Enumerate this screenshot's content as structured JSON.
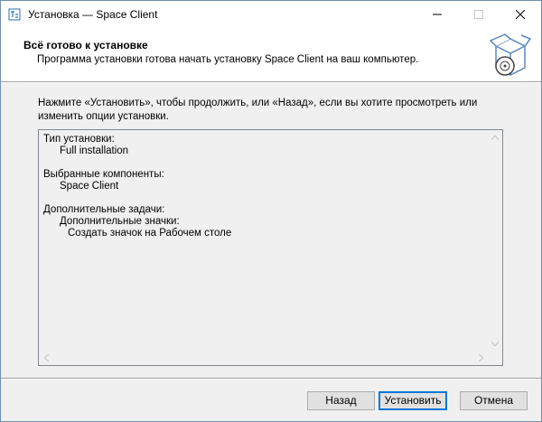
{
  "window": {
    "title": "Установка — Space Client",
    "icons": {
      "app": "installer-app-icon",
      "minimize": "minimize-icon",
      "maximize": "maximize-icon",
      "close": "close-icon"
    }
  },
  "header": {
    "title": "Всё готово к установке",
    "subtitle": "Программа установки готова начать установку Space Client на ваш компьютер.",
    "graphic_icon": "box-with-disc-icon"
  },
  "instructions": {
    "line1": "Нажмите «Установить», чтобы продолжить, или «Назад», если вы хотите просмотреть или",
    "line2": "изменить опции установки."
  },
  "memo": {
    "install_type_label": "Тип установки:",
    "install_type_value": "Full installation",
    "components_label": "Выбранные компоненты:",
    "components_value": "Space Client",
    "tasks_label": "Дополнительные задачи:",
    "tasks_group": "Дополнительные значки:",
    "tasks_item": "Создать значок на Рабочем столе"
  },
  "buttons": {
    "back": "Назад",
    "install": "Установить",
    "cancel": "Отмена"
  },
  "colors": {
    "accent": "#0078d7",
    "dialog_bg": "#f0f0f0",
    "header_bg": "#ffffff"
  }
}
